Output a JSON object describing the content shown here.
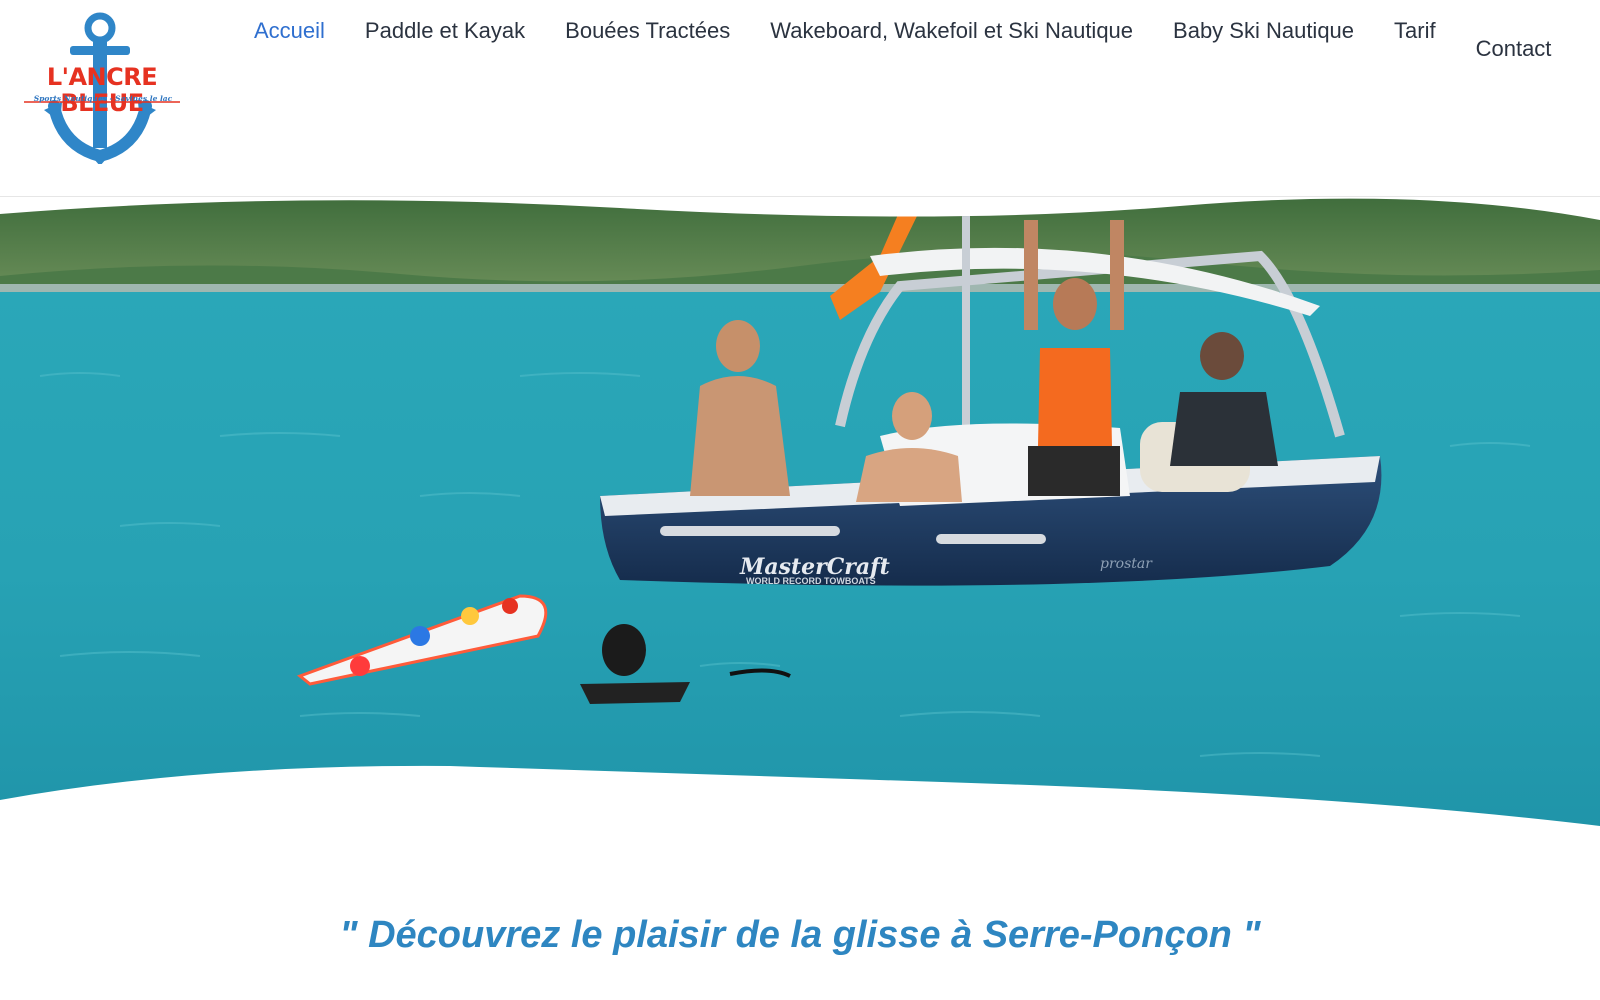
{
  "brand": {
    "name": "L'ANCRE BLEUE",
    "tagline": "Sports Nautiques - Savines le lac",
    "logo_icon": "anchor-icon",
    "colors": {
      "red": "#e63221",
      "blue": "#2f76c0"
    }
  },
  "nav": {
    "items": [
      {
        "label": "Accueil",
        "active": true
      },
      {
        "label": "Paddle et Kayak",
        "active": false
      },
      {
        "label": "Bouées Tractées",
        "active": false
      },
      {
        "label": "Wakeboard, Wakefoil et Ski Nautique",
        "active": false
      },
      {
        "label": "Baby Ski Nautique",
        "active": false
      },
      {
        "label": "Tarif",
        "active": false
      },
      {
        "label": "Contact",
        "active": false
      }
    ],
    "active_color": "#2f6fcf"
  },
  "hero": {
    "boat_brand": "MasterCraft",
    "boat_caption": "WORLD RECORD TOWBOATS",
    "boat_model": "prostar"
  },
  "main": {
    "slogan": "\" Découvrez le plaisir de la glisse à Serre-Ponçon \"",
    "slogan_color": "#2e86c1"
  }
}
